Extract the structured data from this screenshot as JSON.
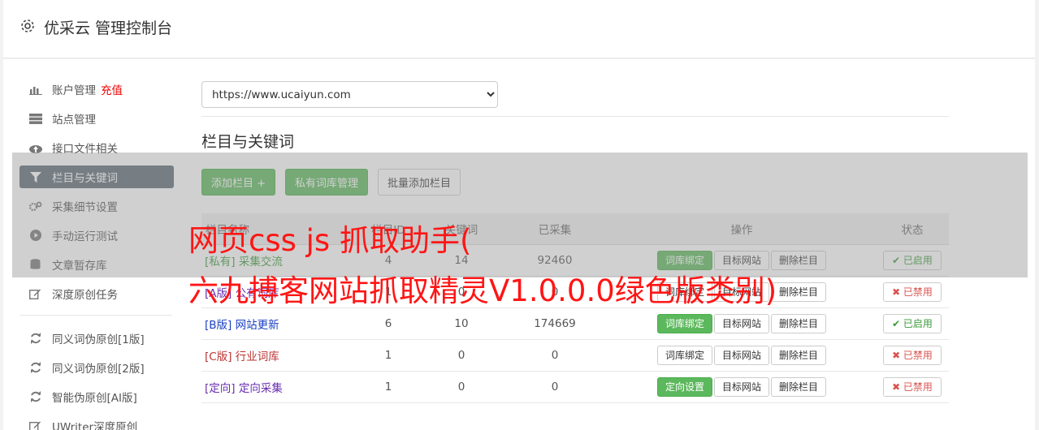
{
  "header": {
    "title": "优采云 管理控制台",
    "icon": "gear-icon"
  },
  "sidebar": {
    "items": [
      {
        "label": "账户管理",
        "extra": "充值",
        "icon": "bar-chart-icon"
      },
      {
        "label": "站点管理",
        "icon": "server-icon"
      },
      {
        "label": "接口文件相关",
        "icon": "cloud-upload-icon"
      },
      {
        "label": "栏目与关键词",
        "icon": "filter-icon",
        "active": true
      },
      {
        "label": "采集细节设置",
        "icon": "cogs-icon"
      },
      {
        "label": "手动运行测试",
        "icon": "play-circle-icon"
      },
      {
        "label": "文章暂存库",
        "icon": "database-icon"
      },
      {
        "label": "深度原创任务",
        "icon": "edit-icon"
      }
    ],
    "items2": [
      {
        "label": "同义词伪原创[1版]",
        "icon": "refresh-icon"
      },
      {
        "label": "同义词伪原创[2版]",
        "icon": "refresh-icon"
      },
      {
        "label": "智能伪原创[AI版]",
        "icon": "refresh-icon"
      },
      {
        "label": "UWriter深度原创",
        "icon": "edit-icon"
      }
    ]
  },
  "site_select": {
    "value": "https://www.ucaiyun.com"
  },
  "section_title": "栏目与关键词",
  "toolbar": {
    "add_column": "添加栏目 +",
    "private_lib": "私有词库管理",
    "batch_add": "批量添加栏目"
  },
  "table": {
    "headers": [
      "栏目名称",
      "栏目ID",
      "关键词",
      "已采集",
      "操作",
      "状态"
    ],
    "rows": [
      {
        "tag": "[私有]",
        "name": "采集交流",
        "cid": "4",
        "kw": "14",
        "collected": "92460",
        "op1": "词库绑定",
        "op2": "目标网站",
        "op3": "删除栏目",
        "status": "✔ 已启用",
        "cls": "cat-green",
        "op1green": true,
        "on": true
      },
      {
        "tag": "[A版]",
        "name": "公有词库",
        "cid": "1",
        "kw": "0",
        "collected": "0",
        "op1": "词库绑定",
        "op2": "目标网站",
        "op3": "删除栏目",
        "status": "✖ 已禁用",
        "cls": "cat-purple",
        "op1green": false,
        "on": false
      },
      {
        "tag": "[B版]",
        "name": "网站更新",
        "cid": "6",
        "kw": "10",
        "collected": "174669",
        "op1": "词库绑定",
        "op2": "目标网站",
        "op3": "删除栏目",
        "status": "✔ 已启用",
        "cls": "cat-blue",
        "op1green": true,
        "on": true
      },
      {
        "tag": "[C版]",
        "name": "行业词库",
        "cid": "1",
        "kw": "0",
        "collected": "0",
        "op1": "词库绑定",
        "op2": "目标网站",
        "op3": "删除栏目",
        "status": "✖ 已禁用",
        "cls": "cat-red",
        "op1green": false,
        "on": false
      },
      {
        "tag": "[定向]",
        "name": "定向采集",
        "cid": "1",
        "kw": "0",
        "collected": "0",
        "op1": "定向设置",
        "op2": "目标网站",
        "op3": "删除栏目",
        "status": "✖ 已禁用",
        "cls": "cat-purple",
        "op1green": true,
        "on": false
      }
    ]
  },
  "watermark": {
    "line1": "网页css js 抓取助手(",
    "line2": "六九搏客网站抓取精灵V1.0.0.0绿色版类别)"
  }
}
